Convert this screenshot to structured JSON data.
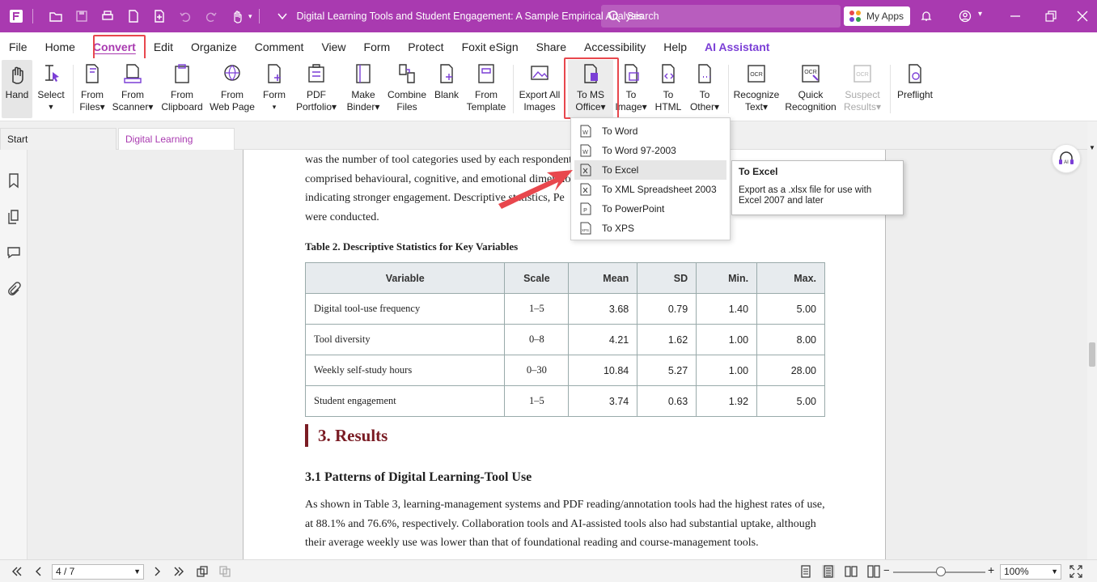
{
  "titlebar": {
    "document_title": "Digital Learning Tools and Student Engagement: A Sample Empirical Analysis",
    "search_placeholder": "Search",
    "my_apps_label": "My Apps"
  },
  "menubar": {
    "items": [
      "File",
      "Home",
      "Convert",
      "Edit",
      "Organize",
      "Comment",
      "View",
      "Form",
      "Protect",
      "Foxit eSign",
      "Share",
      "Accessibility",
      "Help",
      "AI Assistant"
    ],
    "active": "Convert"
  },
  "ribbon": {
    "hand": "Hand",
    "select": "Select",
    "from_files": [
      "From",
      "Files▾"
    ],
    "from_scanner": [
      "From",
      "Scanner▾"
    ],
    "from_clipboard": [
      "From",
      "Clipboard"
    ],
    "from_web_page": [
      "From",
      "Web Page"
    ],
    "form": [
      "Form",
      "▾"
    ],
    "pdf_portfolio": [
      "PDF",
      "Portfolio▾"
    ],
    "make_binder": [
      "Make",
      "Binder▾"
    ],
    "combine_files": [
      "Combine",
      "Files"
    ],
    "blank": "Blank",
    "from_template": [
      "From",
      "Template"
    ],
    "export_all_images": [
      "Export All",
      "Images"
    ],
    "to_ms_office": [
      "To MS",
      "Office▾"
    ],
    "to_image": [
      "To",
      "Image▾"
    ],
    "to_html": [
      "To",
      "HTML"
    ],
    "to_other": [
      "To",
      "Other▾"
    ],
    "recognize_text": [
      "Recognize",
      "Text▾"
    ],
    "quick_recognition": [
      "Quick",
      "Recognition"
    ],
    "suspect_results": [
      "Suspect",
      "Results▾"
    ],
    "preflight": "Preflight"
  },
  "tabs": {
    "start": "Start",
    "document": "Digital Learning Tool..."
  },
  "dropdown": {
    "items": [
      "To Word",
      "To Word 97-2003",
      "To Excel",
      "To XML Spreadsheet 2003",
      "To PowerPoint",
      "To XPS"
    ],
    "hovered": "To Excel"
  },
  "tooltip": {
    "title": "To Excel",
    "body": "Export as a .xlsx file for use with Excel 2007 and later"
  },
  "document": {
    "intro_lines": [
      "was the number of tool categories used by each respondent. Student engagement",
      "comprised behavioural, cognitive, and emotional dimensions",
      "indicating stronger engagement. Descriptive statistics, Pe",
      "were conducted."
    ],
    "table_caption": "Table 2. Descriptive Statistics for Key Variables",
    "table": {
      "headers": [
        "Variable",
        "Scale",
        "Mean",
        "SD",
        "Min.",
        "Max."
      ],
      "rows": [
        [
          "Digital tool-use frequency",
          "1–5",
          "3.68",
          "0.79",
          "1.40",
          "5.00"
        ],
        [
          "Tool diversity",
          "0–8",
          "4.21",
          "1.62",
          "1.00",
          "8.00"
        ],
        [
          "Weekly self-study hours",
          "0–30",
          "10.84",
          "5.27",
          "1.00",
          "28.00"
        ],
        [
          "Student engagement",
          "1–5",
          "3.74",
          "0.63",
          "1.92",
          "5.00"
        ]
      ]
    },
    "section_heading": "3. Results",
    "subsection_heading": "3.1 Patterns of Digital Learning-Tool Use",
    "body_lines": [
      "As shown in Table 3, learning-management systems and PDF reading/annotation tools had the highest rates of use,",
      "at 88.1% and 76.6%, respectively. Collaboration tools and AI-assisted tools also had substantial uptake, although",
      "their average weekly use was lower than that of foundational reading and course-management tools."
    ]
  },
  "statusbar": {
    "page_indicator": "4 / 7",
    "zoom": "100%"
  },
  "colors": {
    "brand": "#a93ab0",
    "highlight": "#e8474d",
    "heading": "#7a1c24"
  }
}
